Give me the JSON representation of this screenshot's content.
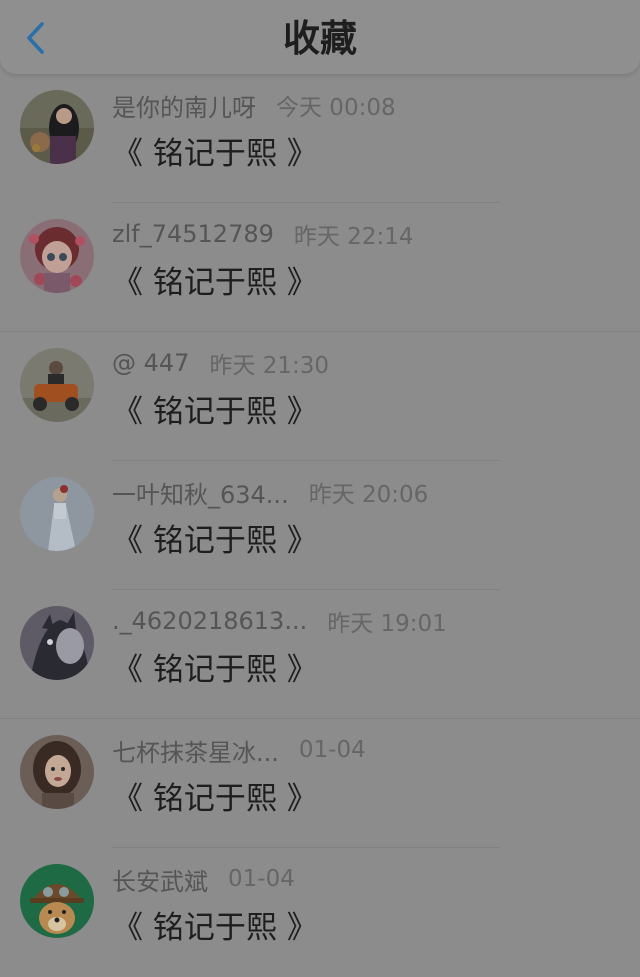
{
  "header": {
    "title": "收藏",
    "back_icon": "chevron-left-icon",
    "accent_color": "#2b6fa8"
  },
  "items": [
    {
      "username": "是你的南儿呀",
      "time": "今天 00:08",
      "content": "《 铭记于熙 》",
      "avatar_icon": "avatar-girl-photo"
    },
    {
      "username": "zlf_74512789",
      "time": "昨天 22:14",
      "content": "《 铭记于熙 》",
      "avatar_icon": "avatar-anime-girl"
    },
    {
      "username": "@ 447",
      "time": "昨天 21:30",
      "content": "《 铭记于熙 》",
      "avatar_icon": "avatar-motorcycle"
    },
    {
      "username": "一叶知秋_634...",
      "time": "昨天 20:06",
      "content": "《 铭记于熙 》",
      "avatar_icon": "avatar-white-dress"
    },
    {
      "username": "._4620218613...",
      "time": "昨天 19:01",
      "content": "《 铭记于熙 》",
      "avatar_icon": "avatar-cat"
    },
    {
      "username": "七杯抹茶星冰...",
      "time": "01-04",
      "content": "《 铭记于熙 》",
      "avatar_icon": "avatar-drawn-girl"
    },
    {
      "username": "长安武斌",
      "time": "01-04",
      "content": "《 铭记于熙 》",
      "avatar_icon": "avatar-doge"
    }
  ]
}
